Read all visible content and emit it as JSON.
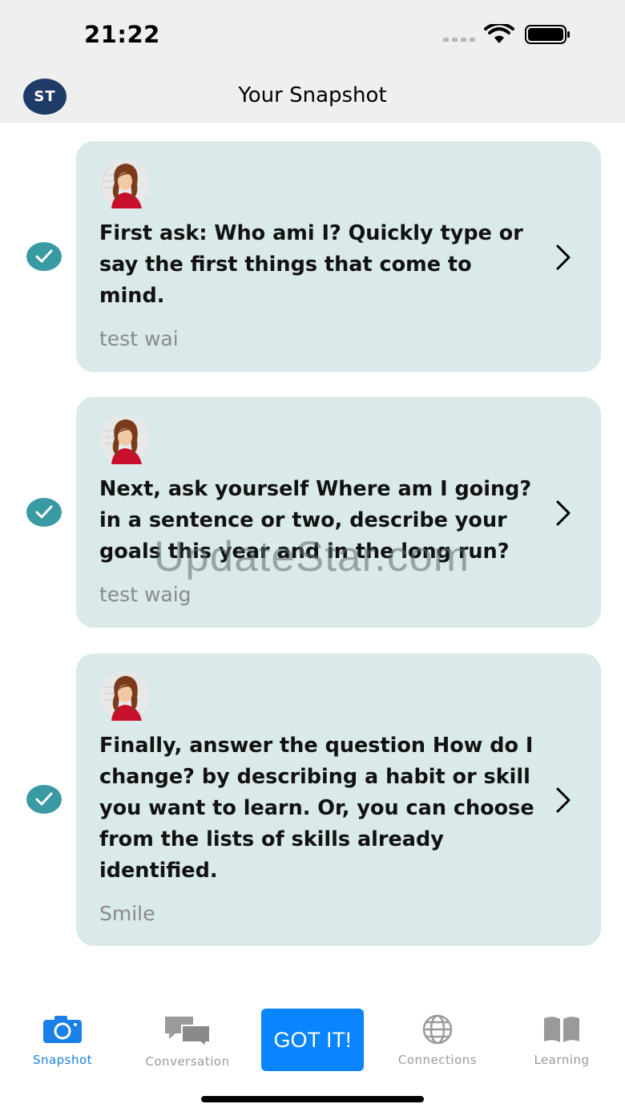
{
  "status_bar": {
    "time": "21:22"
  },
  "header": {
    "avatar_initials": "ST",
    "title": "Your Snapshot"
  },
  "cards": [
    {
      "prompt": "First ask: Who ami I? Quickly type or say the first things that come to mind.",
      "answer": "test wai",
      "checked": true
    },
    {
      "prompt": "Next, ask yourself Where am I going? in a sentence or two, describe your goals this year and in the long run?",
      "answer": "test waig",
      "checked": true
    },
    {
      "prompt": "Finally, answer the question How do I change? by describing a habit or skill you want to learn. Or, you can choose from the lists of skills already identified.",
      "answer": "Smile",
      "checked": true
    }
  ],
  "watermark": "UpdateStar.com",
  "tab_bar": {
    "snapshot": "Snapshot",
    "conversation": "Conversation",
    "got_it": "GOT IT!",
    "connections": "Connections",
    "learning": "Learning"
  },
  "colors": {
    "accent": "#0a84ff",
    "card_bg": "#dae9ea",
    "check": "#3a9aa3",
    "avatar": "#1f3b67"
  }
}
